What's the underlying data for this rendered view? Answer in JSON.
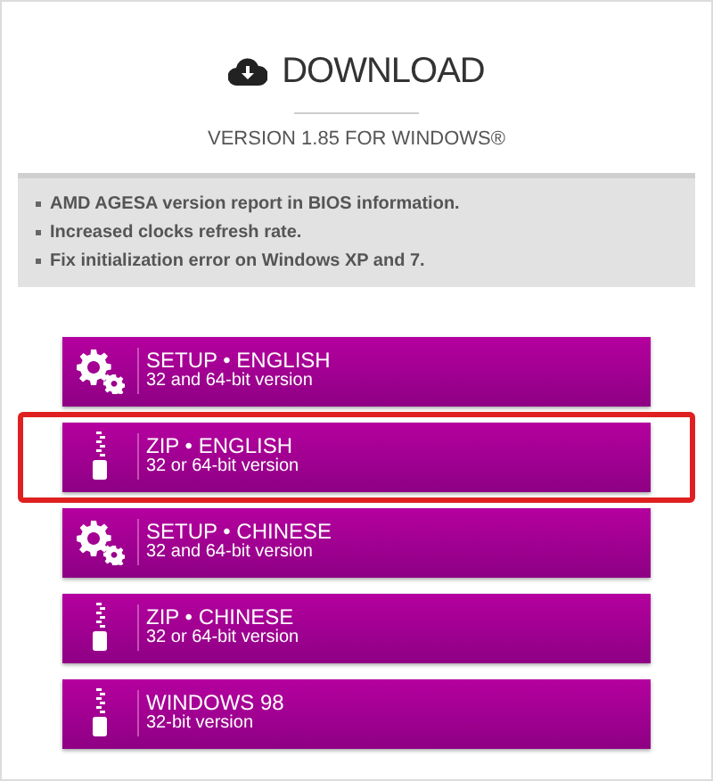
{
  "title": "DOWNLOAD",
  "version": "VERSION 1.85 FOR WINDOWS®",
  "notes": [
    "AMD AGESA version report in BIOS information.",
    "Increased clocks refresh rate.",
    "Fix initialization error on Windows XP and 7."
  ],
  "buttons": [
    {
      "kind": "setup",
      "label": "SETUP • ENGLISH",
      "sublabel": "32 and 64-bit version",
      "highlighted": false
    },
    {
      "kind": "zip",
      "label": "ZIP • ENGLISH",
      "sublabel": "32 or 64-bit version",
      "highlighted": true
    },
    {
      "kind": "setup",
      "label": "SETUP • CHINESE",
      "sublabel": "32 and 64-bit version",
      "highlighted": false
    },
    {
      "kind": "zip",
      "label": "ZIP • CHINESE",
      "sublabel": "32 or 64-bit version",
      "highlighted": false
    },
    {
      "kind": "zip",
      "label": "WINDOWS 98",
      "sublabel": "32-bit version",
      "highlighted": false
    }
  ]
}
